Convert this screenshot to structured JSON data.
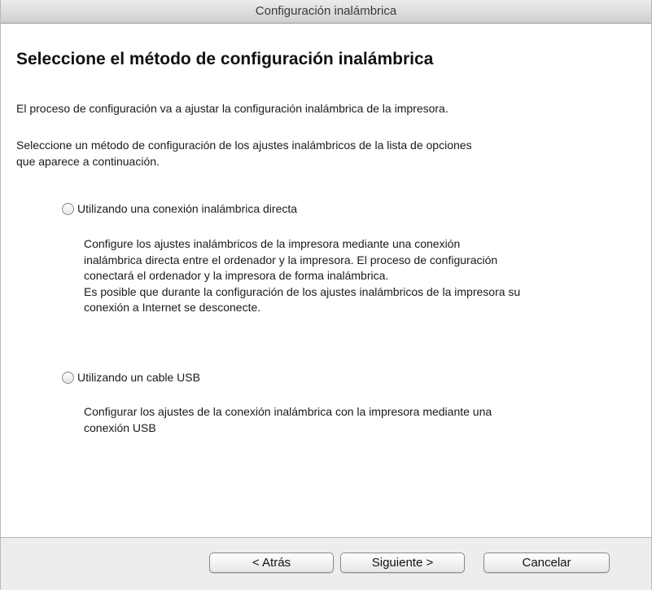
{
  "window": {
    "title": "Configuración inalámbrica"
  },
  "main": {
    "heading": "Seleccione el método de configuración inalámbrica",
    "intro": "El proceso de configuración va a ajustar la configuración inalámbrica de la impresora.",
    "instruction_lines": [
      "Seleccione un método de configuración de los ajustes inalámbricos de la lista de opciones",
      "que aparece a continuación."
    ],
    "options": [
      {
        "label": "Utilizando una conexión inalámbrica directa",
        "selected": false,
        "description_lines": [
          "Configure los ajustes inalámbricos de la impresora mediante una conexión",
          "inalámbrica directa entre el ordenador y la impresora. El proceso de configuración",
          "conectará el ordenador y la impresora de forma inalámbrica.",
          "Es posible que durante la configuración de los ajustes inalámbricos de la impresora su",
          "conexión a Internet se desconecte."
        ]
      },
      {
        "label": "Utilizando un cable USB",
        "selected": false,
        "description_lines": [
          "Configurar los ajustes de la conexión inalámbrica con la impresora mediante una",
          "conexión USB"
        ]
      }
    ]
  },
  "footer": {
    "back_label": "< Atrás",
    "next_label": "Siguiente >",
    "cancel_label": "Cancelar"
  }
}
